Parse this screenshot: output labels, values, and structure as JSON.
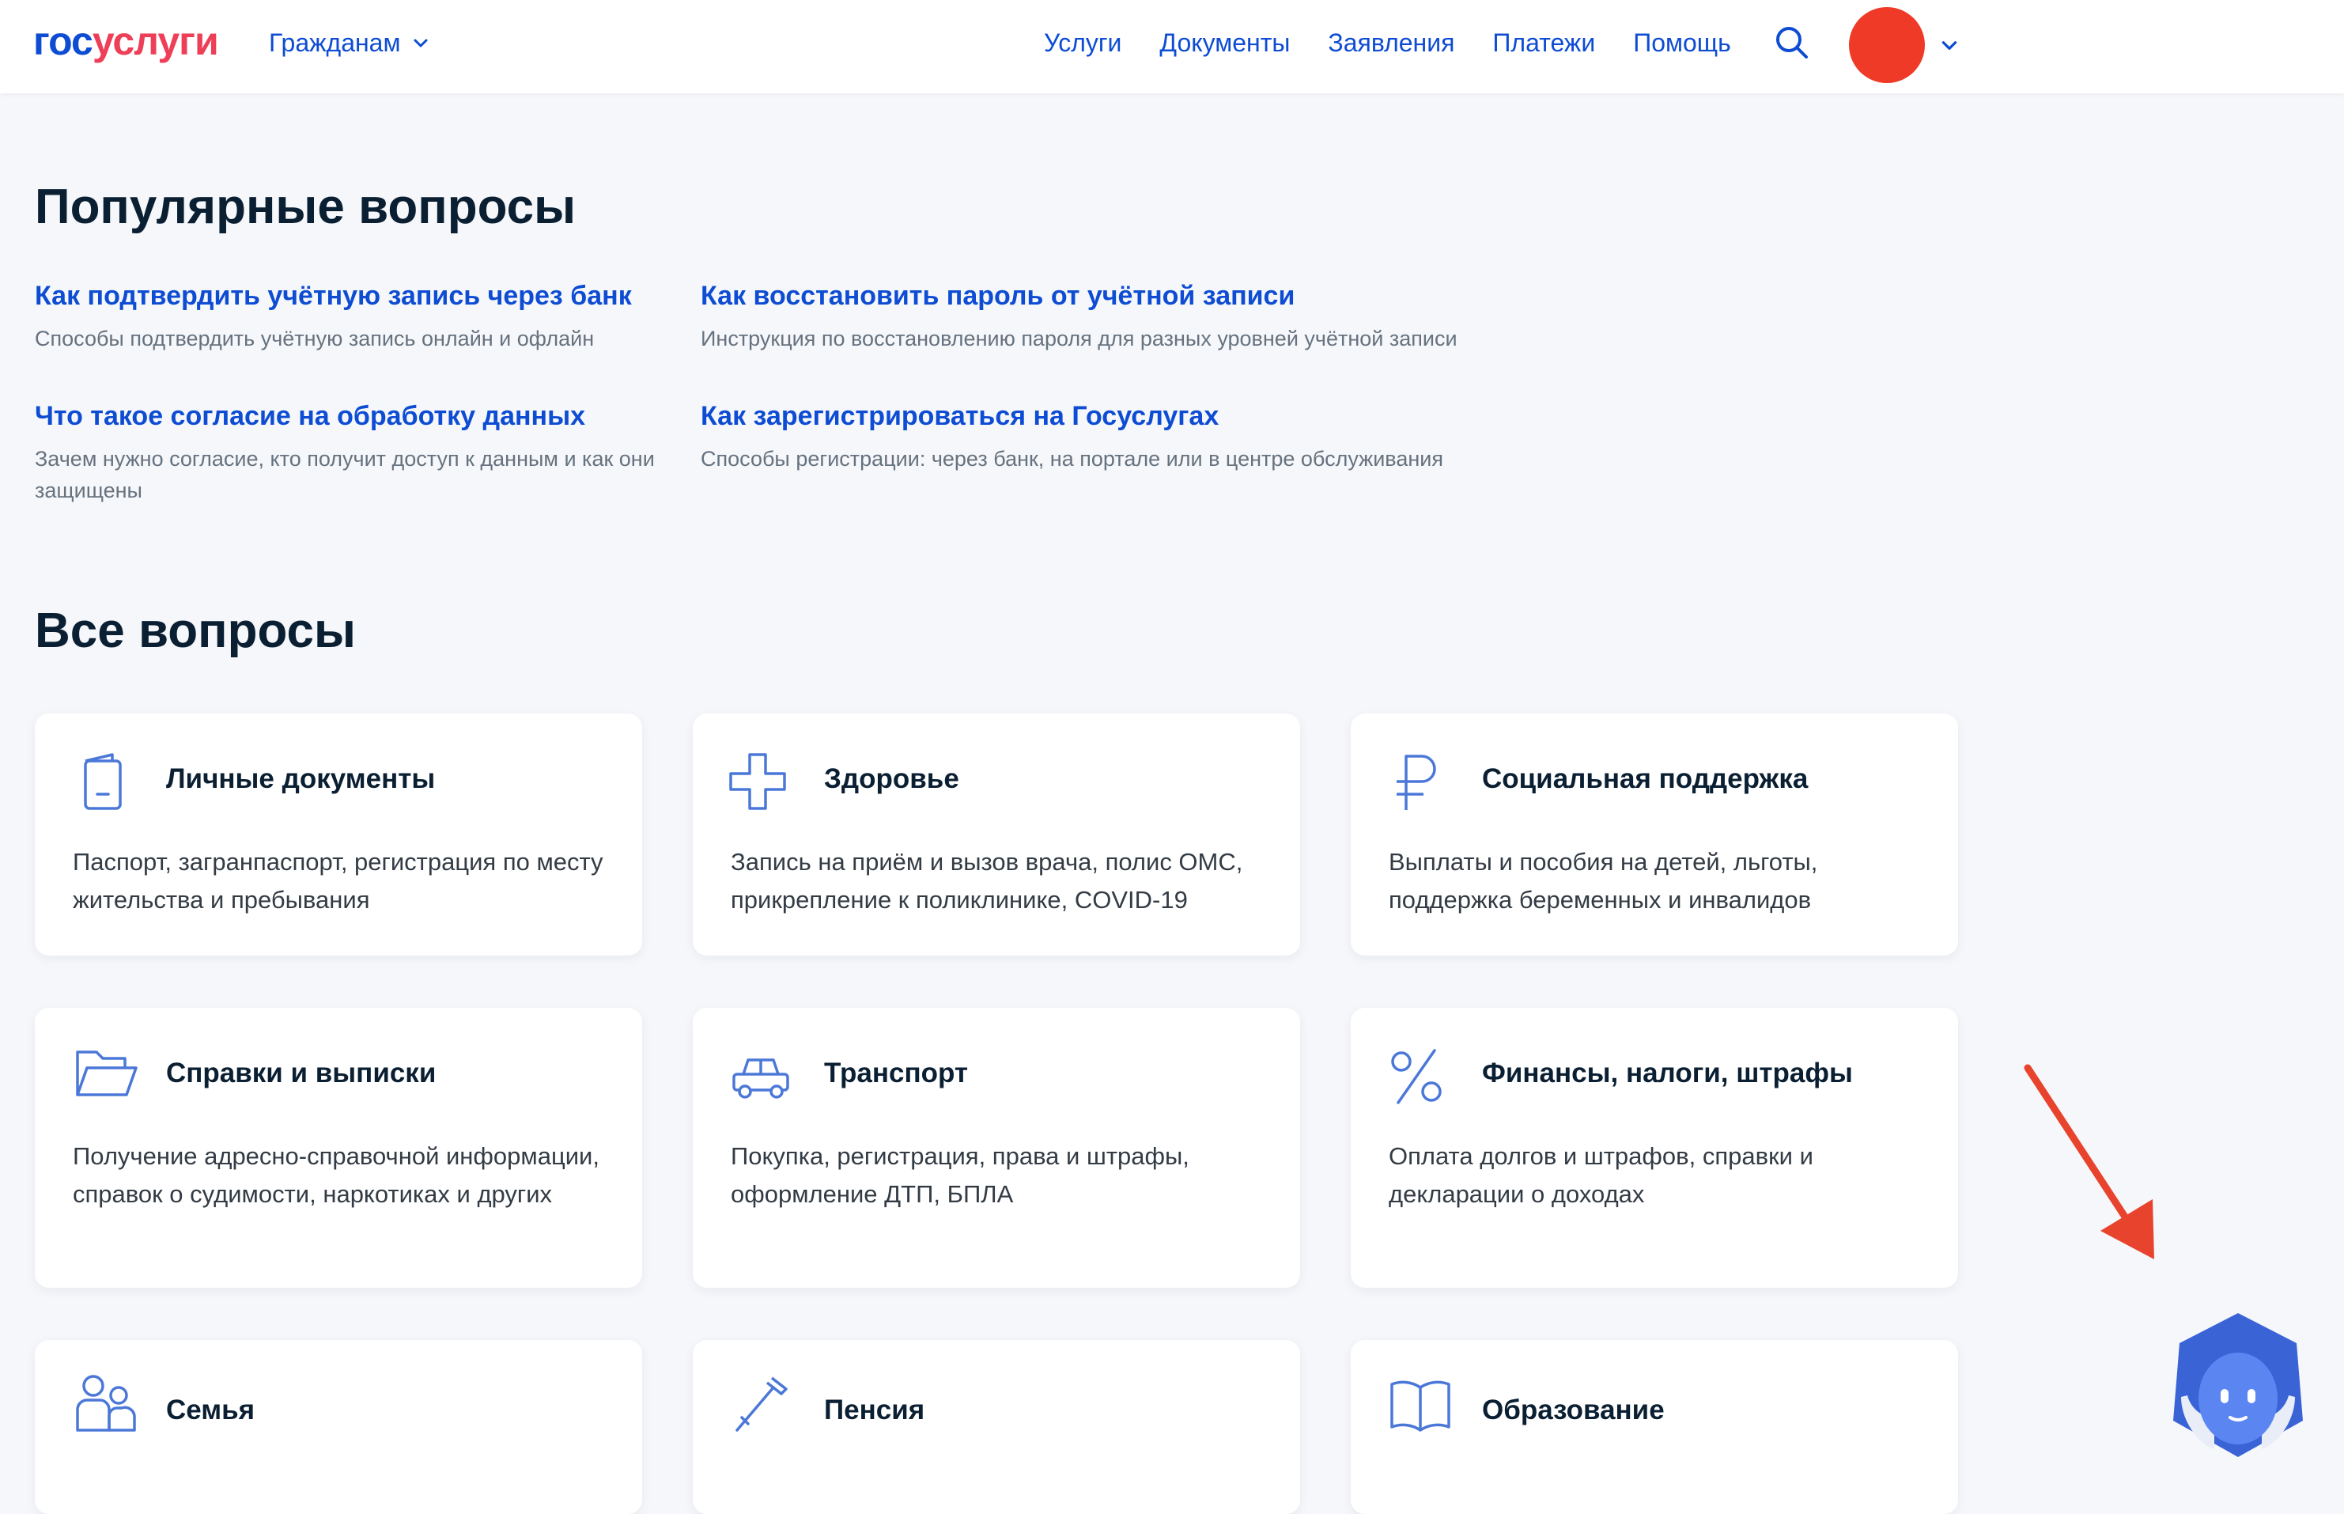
{
  "header": {
    "logo_part1": "гос",
    "logo_part2": "услуги",
    "citizens_label": "Гражданам",
    "nav": [
      "Услуги",
      "Документы",
      "Заявления",
      "Платежи",
      "Помощь"
    ]
  },
  "popular": {
    "title": "Популярные вопросы",
    "items": [
      {
        "title": "Как подтвердить учётную запись через банк",
        "desc": "Способы подтвердить учётную запись онлайн и офлайн"
      },
      {
        "title": "Как восстановить пароль от учётной записи",
        "desc": "Инструкция по восстановлению пароля для разных уровней учётной записи"
      },
      {
        "title": "Что такое согласие на обработку данных",
        "desc": "Зачем нужно согласие, кто получит доступ к данным и как они защищены"
      },
      {
        "title": "Как зарегистрироваться на Госуслугах",
        "desc": "Способы регистрации: через банк, на портале или в центре обслуживания"
      }
    ]
  },
  "all": {
    "title": "Все вопросы",
    "cards": [
      {
        "title": "Личные документы",
        "desc": "Паспорт, загранпаспорт, регистрация по месту жительства и пребывания",
        "icon": "document-icon"
      },
      {
        "title": "Здоровье",
        "desc": "Запись на приём и вызов врача, полис ОМС, прикрепление к поликлинике, COVID-19",
        "icon": "medical-cross-icon"
      },
      {
        "title": "Социальная поддержка",
        "desc": "Выплаты и пособия на детей, льготы, поддержка беременных и инвалидов",
        "icon": "ruble-icon"
      },
      {
        "title": "Справки и выписки",
        "desc": "Получение адресно-справочной информации, справок о судимости, наркотиках и других",
        "icon": "folder-icon"
      },
      {
        "title": "Транспорт",
        "desc": "Покупка, регистрация, права и штрафы, оформление ДТП, БПЛА",
        "icon": "car-icon"
      },
      {
        "title": "Финансы, налоги, штрафы",
        "desc": "Оплата долгов и штрафов, справки и декларации о доходах",
        "icon": "percent-icon"
      },
      {
        "title": "Семья",
        "desc": "",
        "icon": "family-icon"
      },
      {
        "title": "Пенсия",
        "desc": "",
        "icon": "cane-icon"
      },
      {
        "title": "Образование",
        "desc": "",
        "icon": "book-icon"
      }
    ]
  },
  "colors": {
    "brand_blue": "#0d4cd3",
    "brand_red": "#ee3f58",
    "icon_blue": "#4b78d8",
    "avatar": "#ee3a26",
    "annotation_arrow": "#e8432d"
  }
}
